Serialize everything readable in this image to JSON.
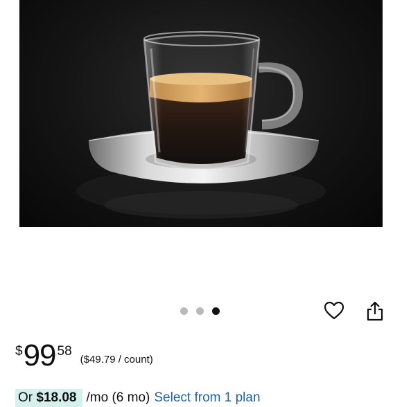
{
  "product_image": {
    "alt": "Glass espresso cup with stainless steel saucer",
    "carousel": {
      "total": 3,
      "active_index": 2
    }
  },
  "actions": {
    "favorite_icon": "heart-icon",
    "share_icon": "share-icon"
  },
  "price": {
    "symbol": "$",
    "whole": "99",
    "fraction": "58",
    "unit_price": "($49.79 / count)"
  },
  "financing": {
    "prefix": "Or",
    "amount": "$18.08",
    "term": "/mo (6 mo)",
    "link": "Select from 1 plan"
  },
  "colors": {
    "link": "#2162a1",
    "financing_highlight": "#d6f0ee",
    "dot_active": "#111111",
    "dot_inactive": "#b9b9b9"
  }
}
